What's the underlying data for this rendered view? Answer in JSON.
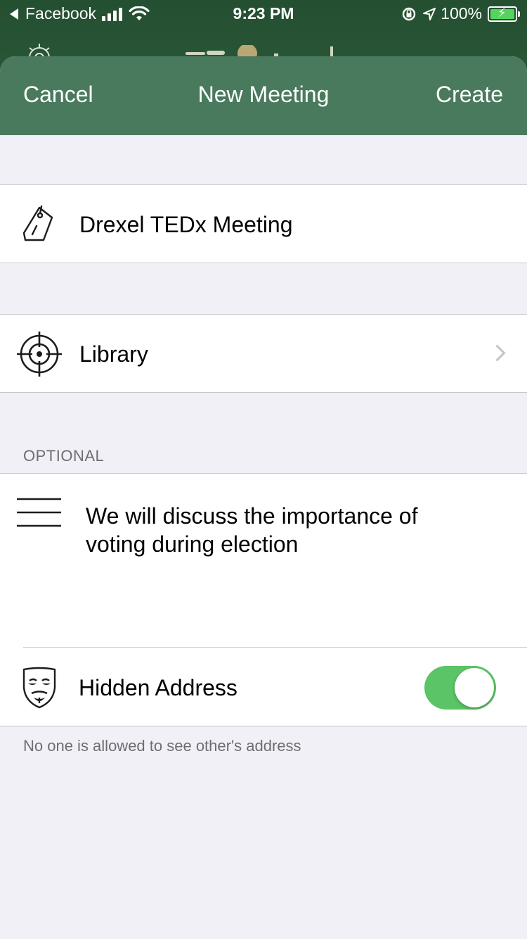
{
  "status_bar": {
    "back_app": "Facebook",
    "time": "9:23 PM",
    "battery": "100%"
  },
  "nav": {
    "cancel_label": "Cancel",
    "title": "New Meeting",
    "create_label": "Create"
  },
  "form": {
    "name_value": "Drexel TEDx Meeting",
    "location_value": "Library",
    "optional_header": "OPTIONAL",
    "description_value": "We will discuss the importance of voting during election",
    "hidden_address_label": "Hidden Address",
    "hidden_address_on": true,
    "hidden_address_footer": "No one is allowed to see other's address"
  },
  "colors": {
    "nav_green": "#4a7a5e",
    "toggle_green": "#5ac466",
    "background": "#f1f0f6"
  },
  "icons": {
    "name": "tag-icon",
    "location": "crosshair-icon",
    "description": "lines-icon",
    "hidden_address": "mask-icon"
  }
}
